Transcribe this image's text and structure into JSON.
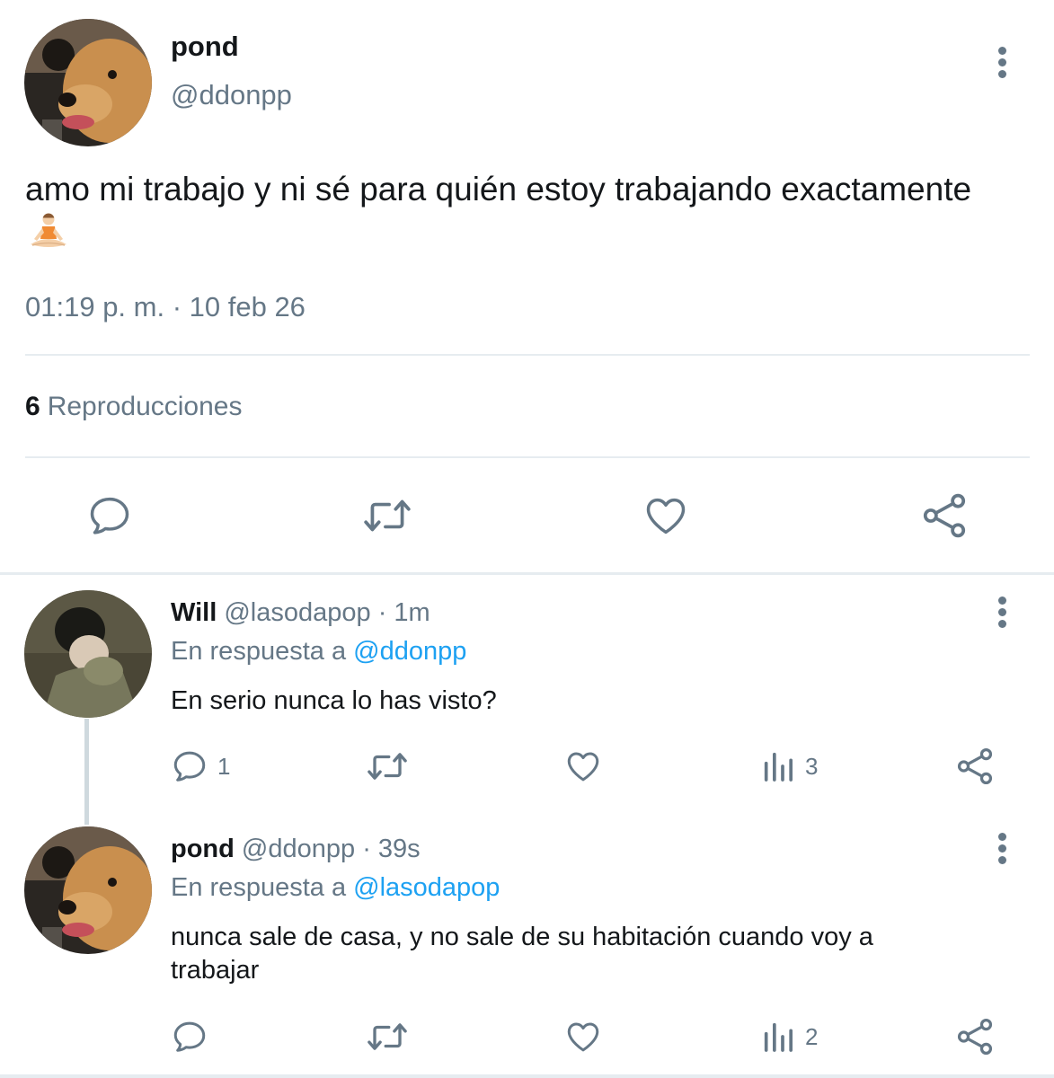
{
  "main_tweet": {
    "name": "pond",
    "handle": "@ddonpp",
    "text": "amo mi trabajo y ni sé para quién estoy trabajando exactamente",
    "emoji": "person-in-lotus-position",
    "timestamp": "01:19 p. m. · 10 feb 26",
    "views_count": "6",
    "views_label": "Reproducciones"
  },
  "replies": [
    {
      "name": "Will",
      "handle": "@lasodapop",
      "time": "· 1m",
      "reply_prefix": "En respuesta a",
      "reply_to": "@ddonpp",
      "text": "En serio nunca lo has visto?",
      "reply_count": "1",
      "retweet_count": "",
      "like_count": "",
      "views_count": "3"
    },
    {
      "name": "pond",
      "handle": "@ddonpp",
      "time": "· 39s",
      "reply_prefix": "En respuesta a",
      "reply_to": "@lasodapop",
      "text": "nunca sale de casa, y no sale de su habitación cuando voy a trabajar",
      "reply_count": "",
      "retweet_count": "",
      "like_count": "",
      "views_count": "2"
    }
  ],
  "icons": [
    "more-vertical-icon",
    "reply-icon",
    "retweet-icon",
    "like-icon",
    "share-icon",
    "views-icon"
  ],
  "colors": {
    "text": "#14171a",
    "muted": "#657786",
    "link": "#1da1f2",
    "divider": "#e6ecf0"
  }
}
